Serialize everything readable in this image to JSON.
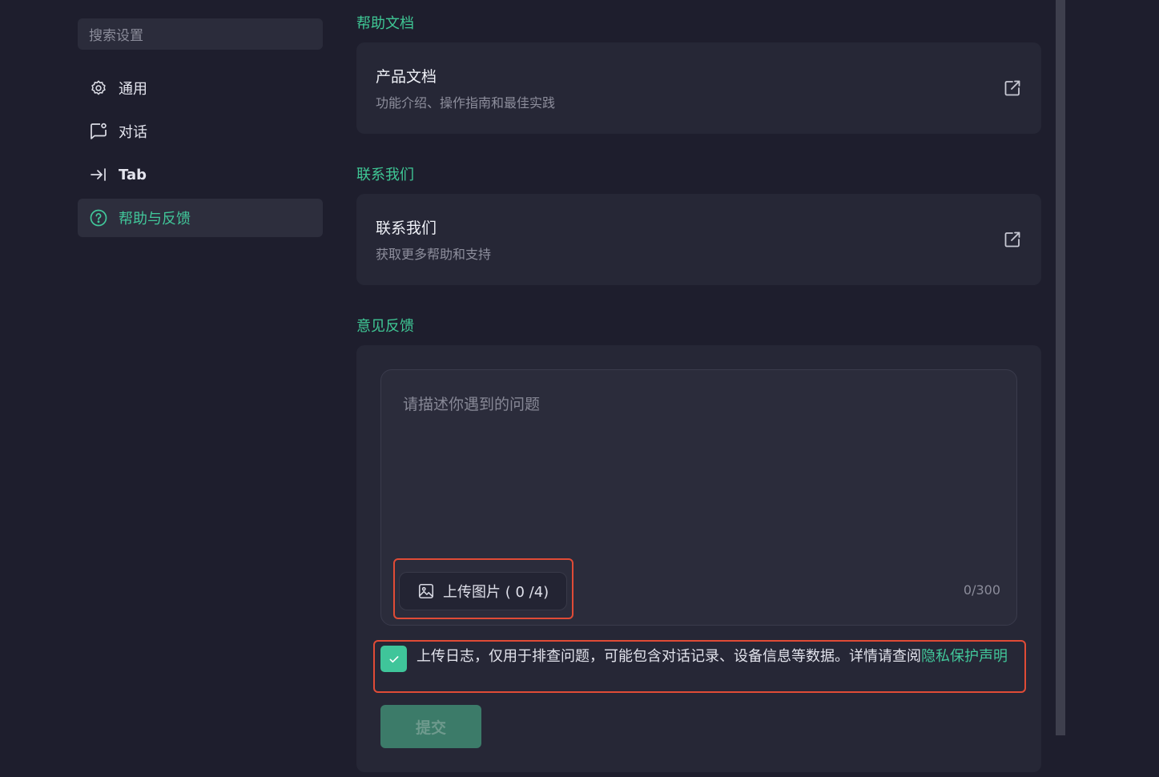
{
  "sidebar": {
    "search_placeholder": "搜索设置",
    "items": [
      {
        "label": "通用",
        "icon": "gear-icon"
      },
      {
        "label": "对话",
        "icon": "chat-icon"
      },
      {
        "label": "Tab",
        "icon": "tab-arrow-icon"
      },
      {
        "label": "帮助与反馈",
        "icon": "help-circle-icon",
        "active": true
      }
    ]
  },
  "sections": {
    "docs_title": "帮助文档",
    "docs_card": {
      "title": "产品文档",
      "subtitle": "功能介绍、操作指南和最佳实践"
    },
    "contact_title": "联系我们",
    "contact_card": {
      "title": "联系我们",
      "subtitle": "获取更多帮助和支持"
    },
    "feedback_title": "意见反馈"
  },
  "feedback": {
    "placeholder": "请描述你遇到的问题",
    "upload_label": "上传图片 ( 0 /4)",
    "counter": "0/300",
    "consent_text": "上传日志，仅用于排查问题，可能包含对话记录、设备信息等数据。详情请查阅",
    "consent_link": "隐私保护声明",
    "consent_checked": true,
    "submit_label": "提交"
  },
  "colors": {
    "accent": "#41c79a",
    "highlight": "#e04b36",
    "background": "#1e1e2d",
    "card": "#262736"
  }
}
